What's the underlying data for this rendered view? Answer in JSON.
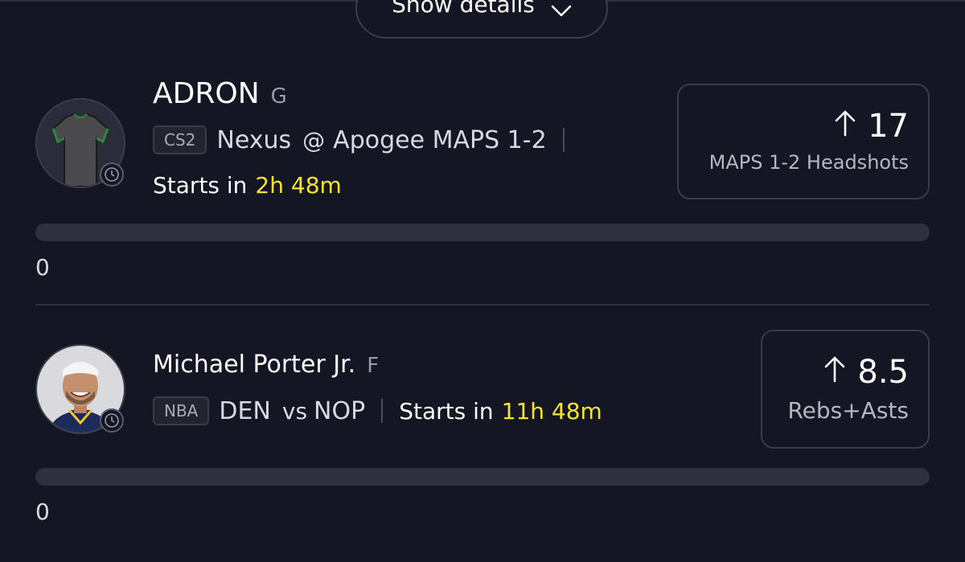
{
  "show_details": {
    "label": "Show details"
  },
  "picks": [
    {
      "name": "ADRON",
      "position": "G",
      "league": "CS2",
      "team_a": "Nexus",
      "separator": "@",
      "team_b": "Apogee MAPS 1-2",
      "starts_prefix": "Starts in",
      "starts_time": "2h 48m",
      "direction": "up",
      "line_value": "17",
      "stat": "MAPS 1-2 Headshots",
      "progress_fraction": 0,
      "current": "0"
    },
    {
      "name": "Michael Porter Jr.",
      "position": "F",
      "league": "NBA",
      "team_a": "DEN",
      "separator": "vs",
      "team_b": "NOP",
      "starts_prefix": "Starts in",
      "starts_time": "11h 48m",
      "direction": "up",
      "line_value": "8.5",
      "stat": "Rebs+Asts",
      "progress_fraction": 0,
      "current": "0"
    }
  ],
  "colors": {
    "background": "#141623",
    "highlight": "#f5e52e",
    "border": "#3a3c4c",
    "track": "#2e3040"
  },
  "icons": [
    "chevron-down-icon",
    "arrow-up-icon",
    "clock-icon",
    "jersey-icon",
    "player-photo"
  ]
}
